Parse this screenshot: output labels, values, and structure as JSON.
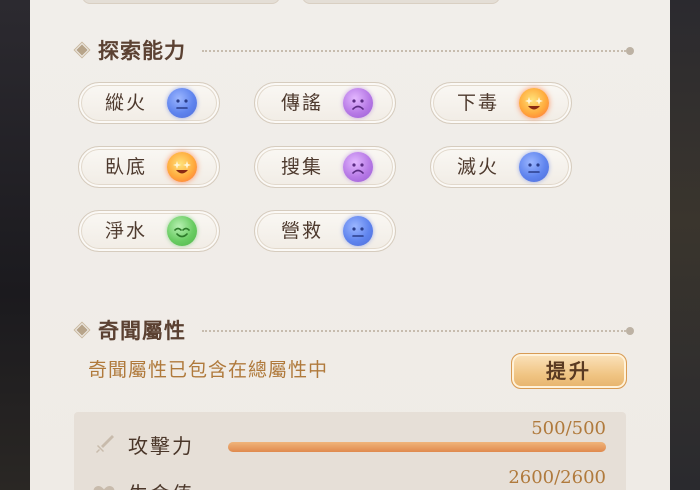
{
  "sections": {
    "exploration": {
      "title": "探索能力"
    },
    "attributes": {
      "title": "奇聞屬性"
    }
  },
  "abilities": [
    {
      "name": "縱火",
      "mood": "neutral",
      "icon": "neutral-face-icon",
      "color": "#5f84ee"
    },
    {
      "name": "傳謠",
      "mood": "sad",
      "icon": "sad-face-icon",
      "color": "#b77ae6"
    },
    {
      "name": "下毒",
      "mood": "excited",
      "icon": "excited-face-icon",
      "color": "#ff8a3a"
    },
    {
      "name": "臥底",
      "mood": "excited",
      "icon": "excited-face-icon",
      "color": "#ff8a3a"
    },
    {
      "name": "搜集",
      "mood": "sad",
      "icon": "sad-face-icon",
      "color": "#b77ae6"
    },
    {
      "name": "滅火",
      "mood": "neutral",
      "icon": "neutral-face-icon",
      "color": "#5f84ee"
    },
    {
      "name": "淨水",
      "mood": "happy",
      "icon": "happy-face-icon",
      "color": "#69cc62"
    },
    {
      "name": "營救",
      "mood": "neutral",
      "icon": "neutral-face-icon",
      "color": "#5f84ee"
    }
  ],
  "attributes": {
    "description": "奇聞屬性已包含在總屬性中",
    "upgrade_label": "提升",
    "stats": [
      {
        "label": "攻擊力",
        "value_text": "500/500",
        "fraction": 1.0,
        "icon": "sword-icon"
      },
      {
        "label": "生命值",
        "value_text": "2600/2600",
        "fraction": 1.0,
        "icon": "heart-icon"
      }
    ]
  },
  "colors": {
    "accent": "#e08a4e",
    "title_text": "#5b4132",
    "desc_text": "#b07a3c",
    "button": "#f0c584"
  }
}
